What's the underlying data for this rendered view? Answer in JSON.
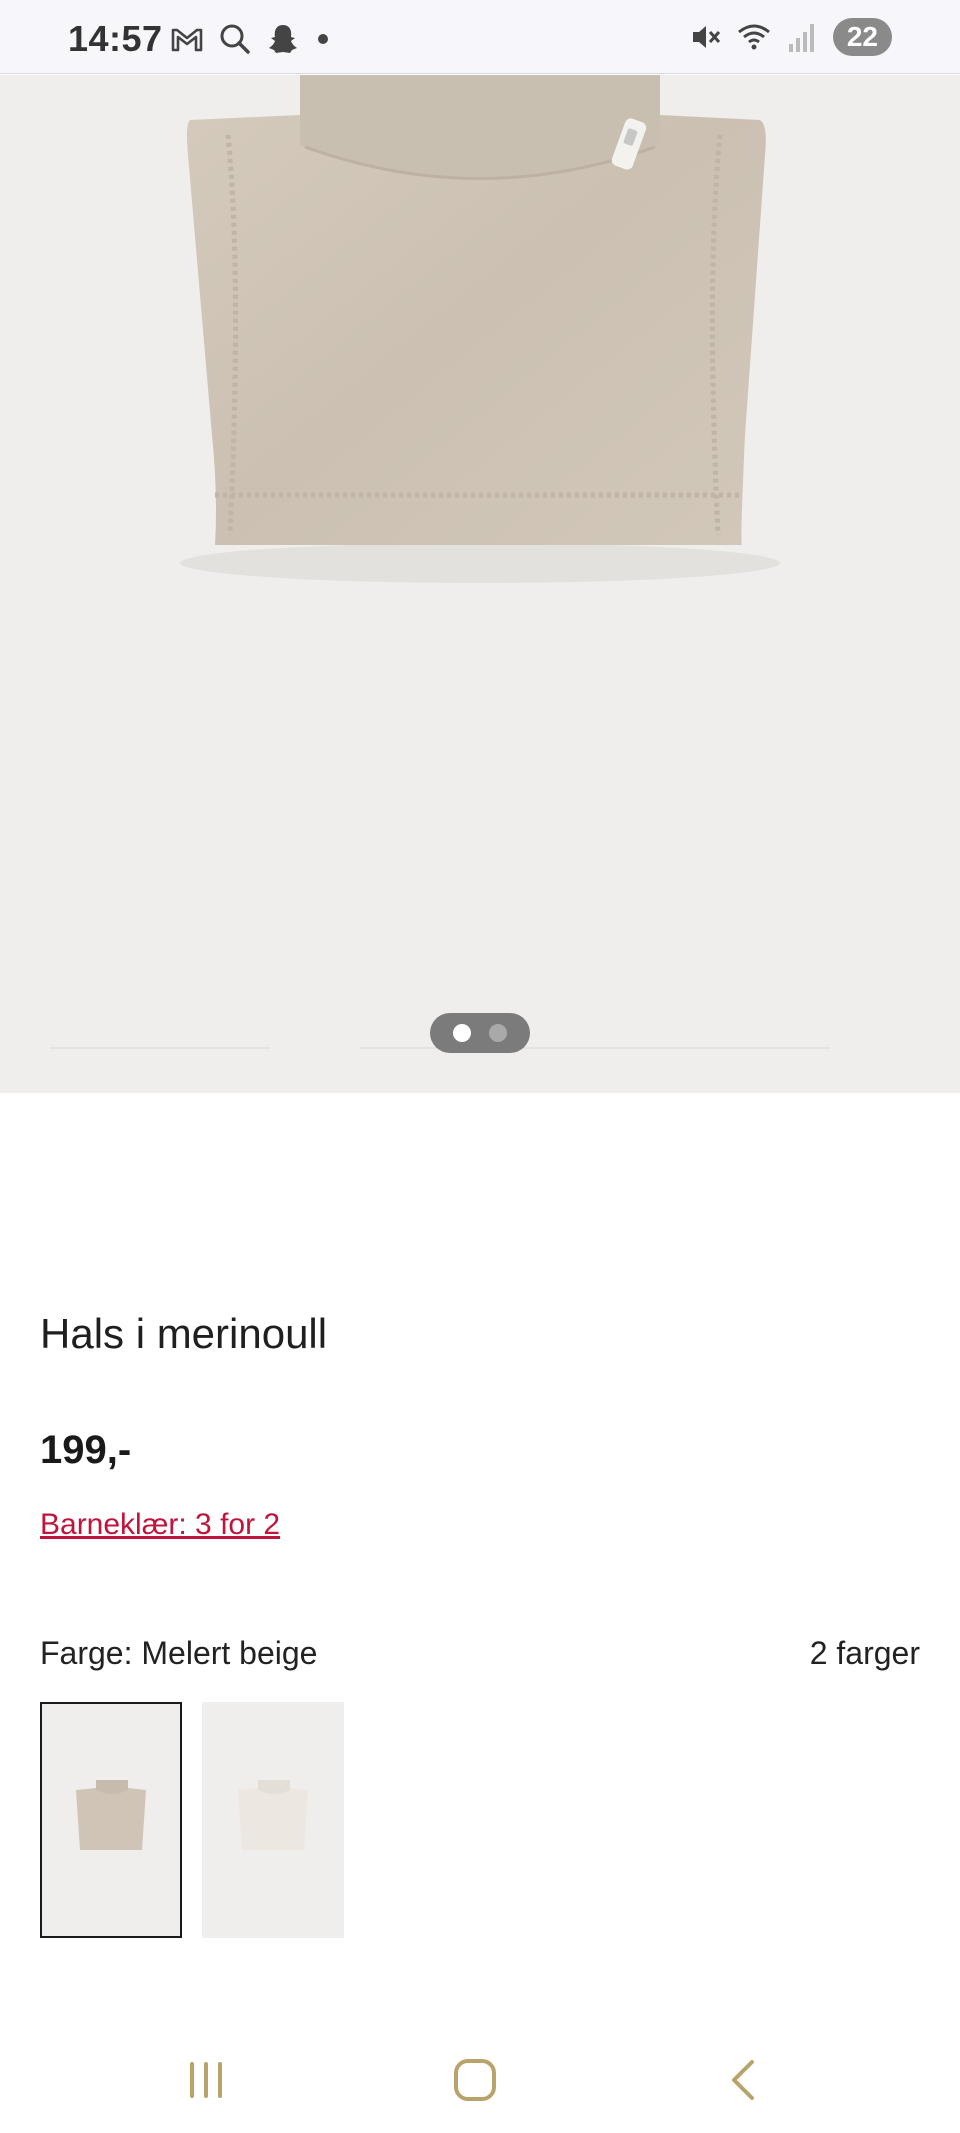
{
  "status_bar": {
    "time": "14:57",
    "left_icons": [
      "gmail-icon",
      "search-icon",
      "snapchat-icon",
      "notification-dot-icon"
    ],
    "right_icons": [
      "mute-icon",
      "wifi-icon",
      "signal-icon"
    ],
    "battery": "22"
  },
  "gallery": {
    "image_count": 2,
    "active_index": 0
  },
  "product": {
    "title": "Hals i merinoull",
    "price": "199,-",
    "promo_link": "Barneklær: 3 for 2",
    "color_label": "Farge: Melert beige",
    "color_count": "2 farger",
    "swatches": [
      {
        "name": "Melert beige",
        "color": "#cfc4b6",
        "selected": true
      },
      {
        "name": "Natural white",
        "color": "#ece8e1",
        "selected": false
      }
    ]
  },
  "colors": {
    "promo": "#c0143c",
    "image_bg": "#efeeec",
    "product_beige": "#cfc4b6"
  },
  "nav_bar": {
    "buttons": [
      "recent-apps-icon",
      "home-icon",
      "back-icon"
    ]
  }
}
